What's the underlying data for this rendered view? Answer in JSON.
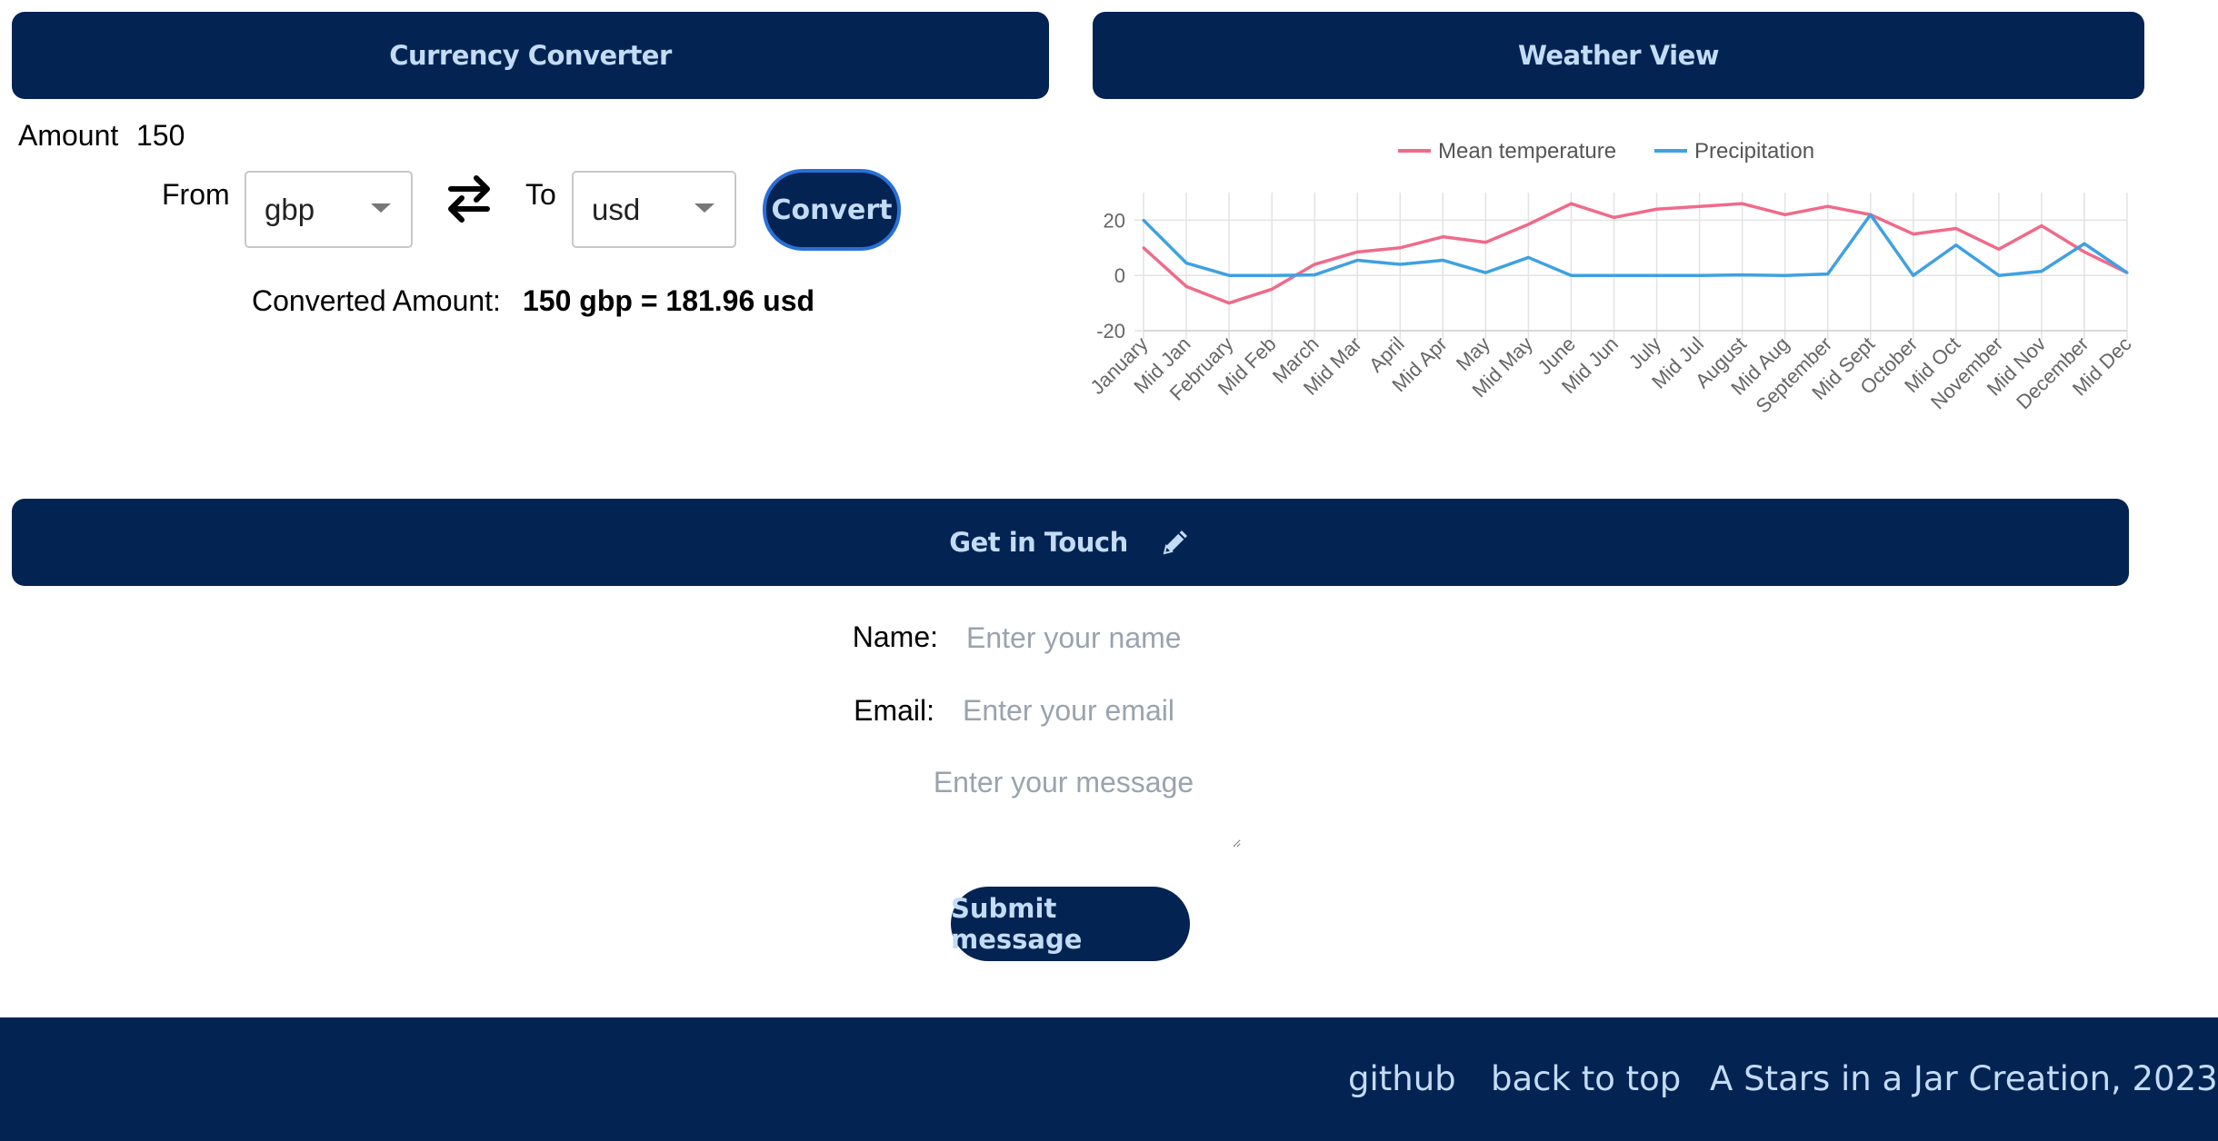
{
  "currency": {
    "title": "Currency Converter",
    "amount_label": "Amount",
    "amount_value": "150",
    "from_label": "From",
    "from_value": "gbp",
    "to_label": "To",
    "to_value": "usd",
    "convert_label": "Convert",
    "converted_label": "Converted Amount:",
    "converted_result": "150 gbp = 181.96 usd"
  },
  "weather": {
    "title": "Weather View"
  },
  "chart_data": {
    "type": "line",
    "categories": [
      "January",
      "Mid Jan",
      "February",
      "Mid Feb",
      "March",
      "Mid Mar",
      "April",
      "Mid Apr",
      "May",
      "Mid May",
      "June",
      "Mid Jun",
      "July",
      "Mid Jul",
      "August",
      "Mid Aug",
      "September",
      "Mid Sept",
      "October",
      "Mid Oct",
      "November",
      "Mid Nov",
      "December",
      "Mid Dec"
    ],
    "series": [
      {
        "name": "Mean temperature",
        "color": "#f06a8a",
        "values": [
          10,
          -4,
          -10,
          -5,
          4,
          8.5,
          10,
          14,
          12,
          18.5,
          26,
          21,
          24,
          25,
          26,
          22,
          25,
          22,
          15,
          17,
          9.5,
          18,
          8.5,
          1
        ]
      },
      {
        "name": "Precipitation",
        "color": "#3fa1e0",
        "values": [
          20,
          4.5,
          0,
          0,
          0.2,
          5.5,
          4,
          5.5,
          1,
          6.5,
          0,
          0,
          0,
          0,
          0.2,
          0,
          0.5,
          22,
          0,
          11,
          0,
          1.5,
          11.5,
          1
        ]
      }
    ],
    "yticks": [
      20,
      0,
      -20
    ],
    "ylim": [
      -20,
      30
    ],
    "grid": true,
    "legend": "top-center"
  },
  "contact": {
    "title": "Get in Touch",
    "name_label": "Name:",
    "name_placeholder": "Enter your name",
    "email_label": "Email:",
    "email_placeholder": "Enter your email",
    "message_placeholder": "Enter your message",
    "submit_label": "Submit message"
  },
  "footer": {
    "github": "github",
    "back_to_top": "back to top",
    "credit": "A Stars in a Jar Creation, 2023"
  },
  "colors": {
    "header_bg": "#032353",
    "header_text": "#c3dcf5",
    "convert_border": "#2a6fd6"
  },
  "icons": [
    "swap-arrows-icon",
    "pencil-icon",
    "chevron-down-icon"
  ]
}
